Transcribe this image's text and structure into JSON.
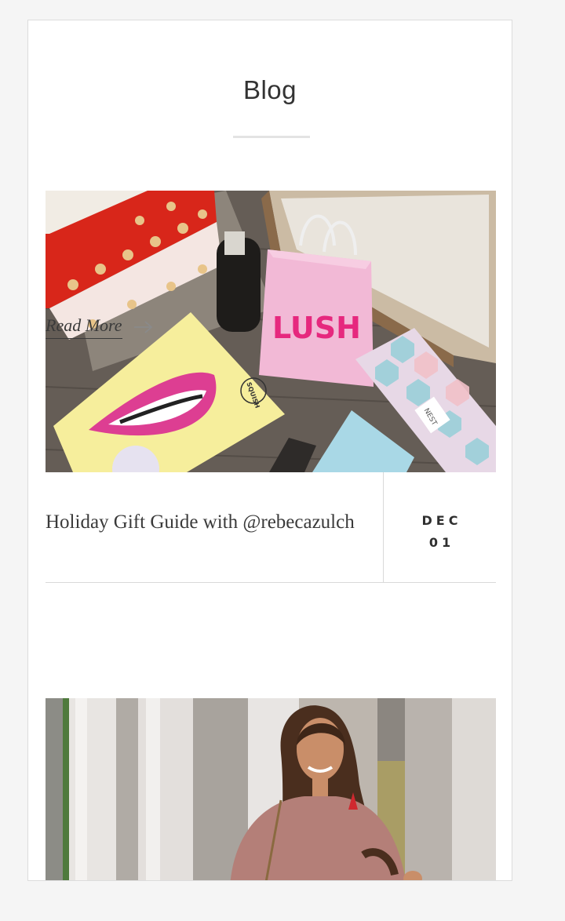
{
  "page": {
    "title": "Blog"
  },
  "posts": [
    {
      "title": "Holiday Gift Guide with @rebecazulch",
      "date_month": "DEC",
      "date_day": "01",
      "read_more_label": "Read More",
      "image": {
        "bag_text": "LUSH",
        "box_text": "NEST",
        "brand_badge": "SQUISH"
      }
    },
    {
      "image": {}
    }
  ],
  "colors": {
    "card_background": "#ffffff",
    "page_background": "#f5f5f5",
    "text": "#3a3a3a",
    "divider": "#d9d9d9"
  }
}
